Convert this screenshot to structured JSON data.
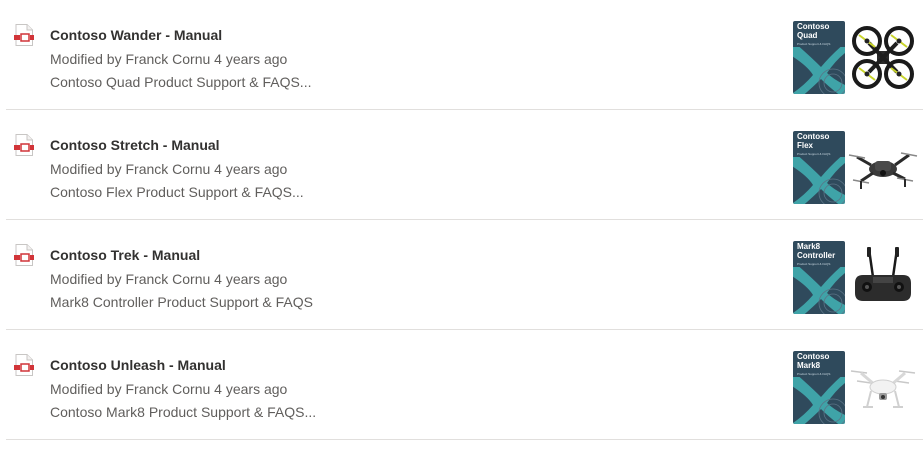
{
  "documents": [
    {
      "title": "Contoso Wander - Manual",
      "modified": "Modified by Franck Cornu 4 years ago",
      "description": "Contoso Quad Product Support & FAQS...",
      "cover_title": "Contoso\nQuad",
      "cover_subtitle": "Product Support & FAQS",
      "product_icon": "quadcopter-image"
    },
    {
      "title": "Contoso Stretch - Manual",
      "modified": "Modified by Franck Cornu 4 years ago",
      "description": "Contoso Flex Product Support & FAQS...",
      "cover_title": "Contoso\nFlex",
      "cover_subtitle": "Product Support & FAQS",
      "product_icon": "drone-image"
    },
    {
      "title": "Contoso Trek - Manual",
      "modified": "Modified by Franck Cornu 4 years ago",
      "description": "Mark8 Controller Product Support & FAQS",
      "cover_title": "Mark8\nController",
      "cover_subtitle": "Product Support & FAQS",
      "product_icon": "controller-image"
    },
    {
      "title": "Contoso Unleash - Manual",
      "modified": "Modified by Franck Cornu 4 years ago",
      "description": "Contoso Mark8 Product Support & FAQS...",
      "cover_title": "Contoso\nMark8",
      "cover_subtitle": "Product Support & FAQS",
      "product_icon": "white-drone-image"
    }
  ],
  "colors": {
    "cover_background": "#2f4a5c",
    "cover_accent": "#3fa3a8",
    "file_icon_red": "#d13438",
    "divider": "#e1dfdd"
  }
}
